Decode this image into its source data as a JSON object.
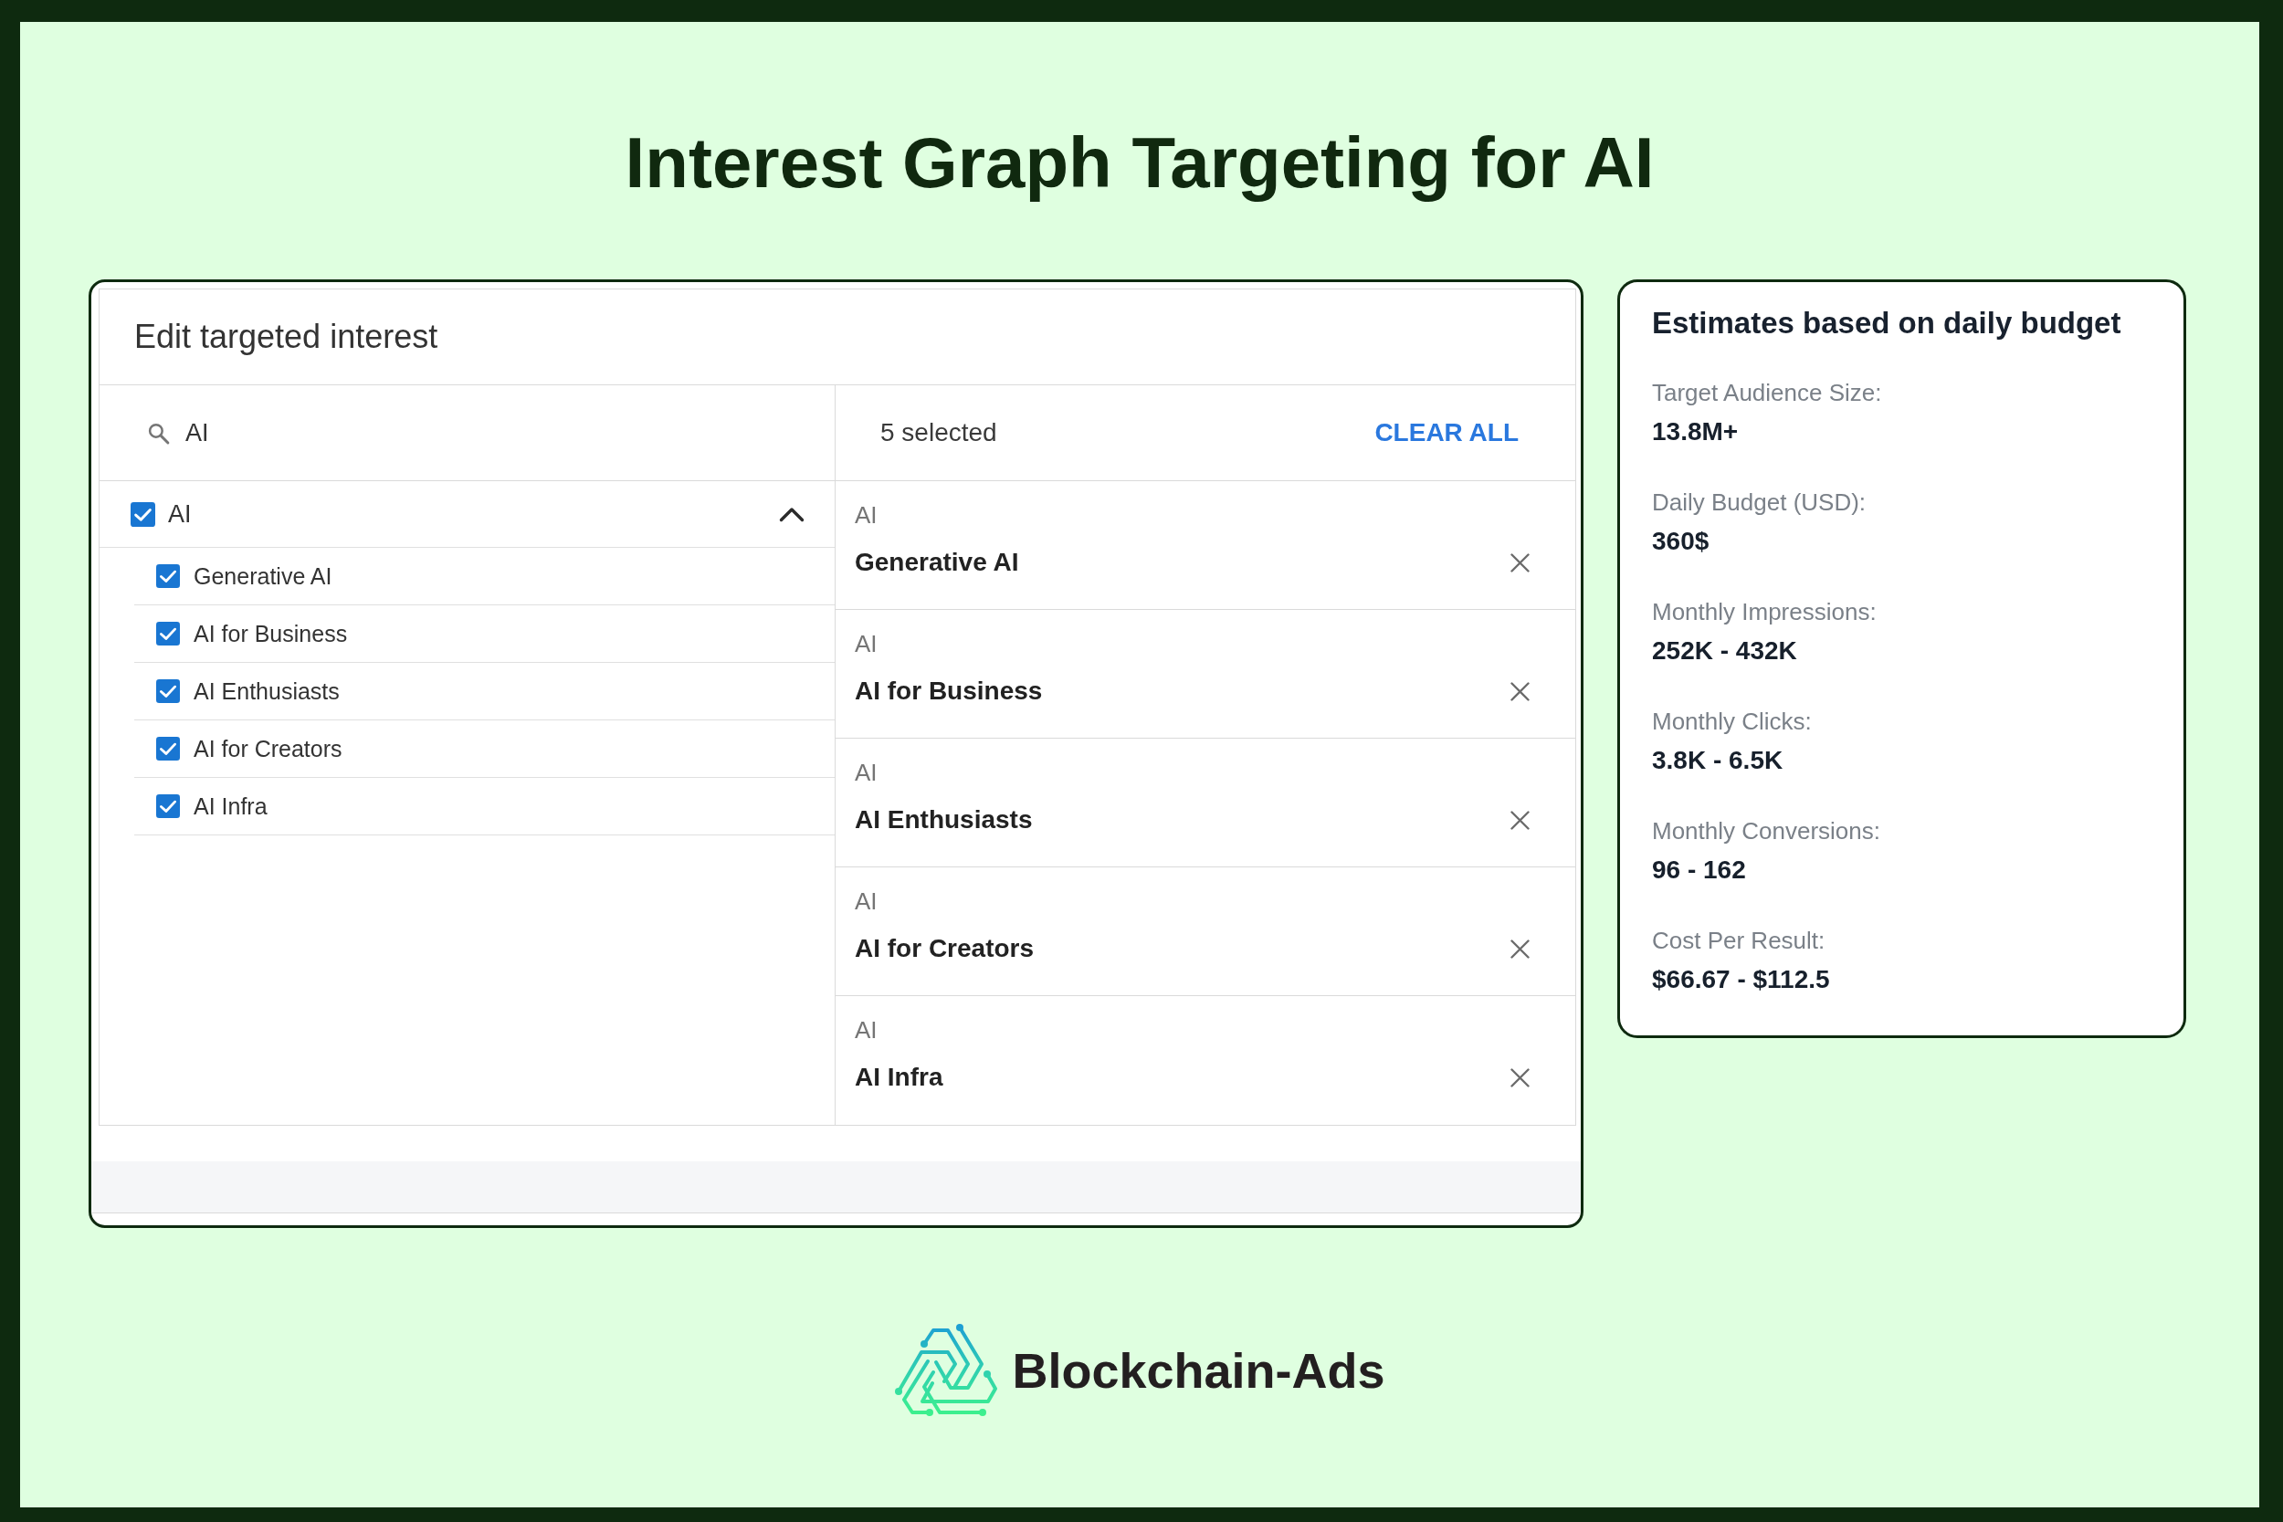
{
  "title": "Interest Graph Targeting for AI",
  "dialog": {
    "title": "Edit targeted interest",
    "search": {
      "value": "AI"
    },
    "tree": [
      {
        "label": "AI",
        "checked": true,
        "expanded": true,
        "children": [
          {
            "label": "Generative AI",
            "checked": true
          },
          {
            "label": "AI for Business",
            "checked": true
          },
          {
            "label": "AI Enthusiasts",
            "checked": true
          },
          {
            "label": "AI for Creators",
            "checked": true
          },
          {
            "label": "AI Infra",
            "checked": true
          }
        ]
      }
    ],
    "selection": {
      "count_label": "5 selected",
      "clear_button": "CLEAR ALL",
      "items": [
        {
          "category": "AI",
          "name": "Generative AI"
        },
        {
          "category": "AI",
          "name": "AI for Business"
        },
        {
          "category": "AI",
          "name": "AI Enthusiasts"
        },
        {
          "category": "AI",
          "name": "AI for Creators"
        },
        {
          "category": "AI",
          "name": "AI Infra"
        }
      ]
    }
  },
  "estimates": {
    "title": "Estimates based on daily budget",
    "metrics": [
      {
        "label": "Target Audience Size:",
        "value": "13.8M+"
      },
      {
        "label": "Daily Budget (USD):",
        "value": "360$"
      },
      {
        "label": "Monthly Impressions:",
        "value": "252K - 432K"
      },
      {
        "label": "Monthly Clicks:",
        "value": "3.8K - 6.5K"
      },
      {
        "label": "Monthly Conversions:",
        "value": "96 - 162"
      },
      {
        "label": "Cost Per Result:",
        "value": "$66.67 - $112.5"
      }
    ]
  },
  "logo": {
    "text": "Blockchain-Ads"
  }
}
